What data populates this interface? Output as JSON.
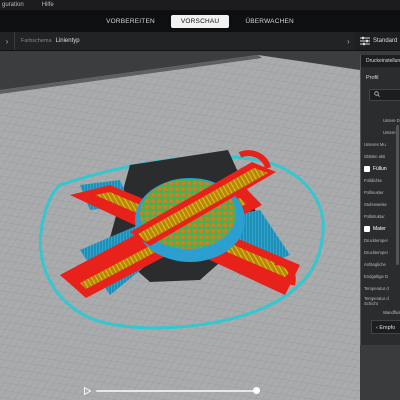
{
  "menu": {
    "items": [
      "guration",
      "Hilfe"
    ]
  },
  "stages": [
    {
      "label": "VORBEREITEN",
      "active": false
    },
    {
      "label": "VORSCHAU",
      "active": true
    },
    {
      "label": "ÜBERWACHEN",
      "active": false
    }
  ],
  "toolbar": {
    "color_scheme_label": "Farbschema",
    "color_scheme_value": "Linientyp",
    "settings_text": "Standard"
  },
  "panel": {
    "title": "Druckeinstellun",
    "profile_label": "Profil",
    "rows": [
      {
        "text": "Untere Di",
        "type": "indent"
      },
      {
        "text": "Untere F",
        "type": "indent"
      },
      {
        "text": "Unteres Mu",
        "type": "plain"
      },
      {
        "text": "Glätten akti",
        "type": "plain"
      },
      {
        "text": "Füllun",
        "type": "header"
      },
      {
        "text": "Fülldichte",
        "type": "plain"
      },
      {
        "text": "Füllmuster",
        "type": "plain"
      },
      {
        "text": "Stufenweise",
        "type": "plain"
      },
      {
        "text": "Füllstruktur",
        "type": "plain"
      },
      {
        "text": "Mater",
        "type": "header"
      },
      {
        "text": "Drucktemper",
        "type": "plain"
      },
      {
        "text": "Drucktemper",
        "type": "plain"
      },
      {
        "text": "Anfängliche",
        "type": "plain"
      },
      {
        "text": "Endgültige D",
        "type": "plain"
      },
      {
        "text": "Temperatur d",
        "type": "plain"
      },
      {
        "text": "Temperatur d Schicht",
        "type": "two"
      },
      {
        "text": "Wandfluss",
        "type": "indent"
      }
    ],
    "footer_label": "Empfo"
  },
  "colors": {
    "accent": "#ffffff",
    "wall_red": "#e8221b",
    "travel_cyan": "#32c8d2",
    "infill_orange": "#e07a1a",
    "skin_yellow": "#e8d21a",
    "support_blue": "#2a9fd0"
  },
  "player": {
    "progress": 0.98
  }
}
